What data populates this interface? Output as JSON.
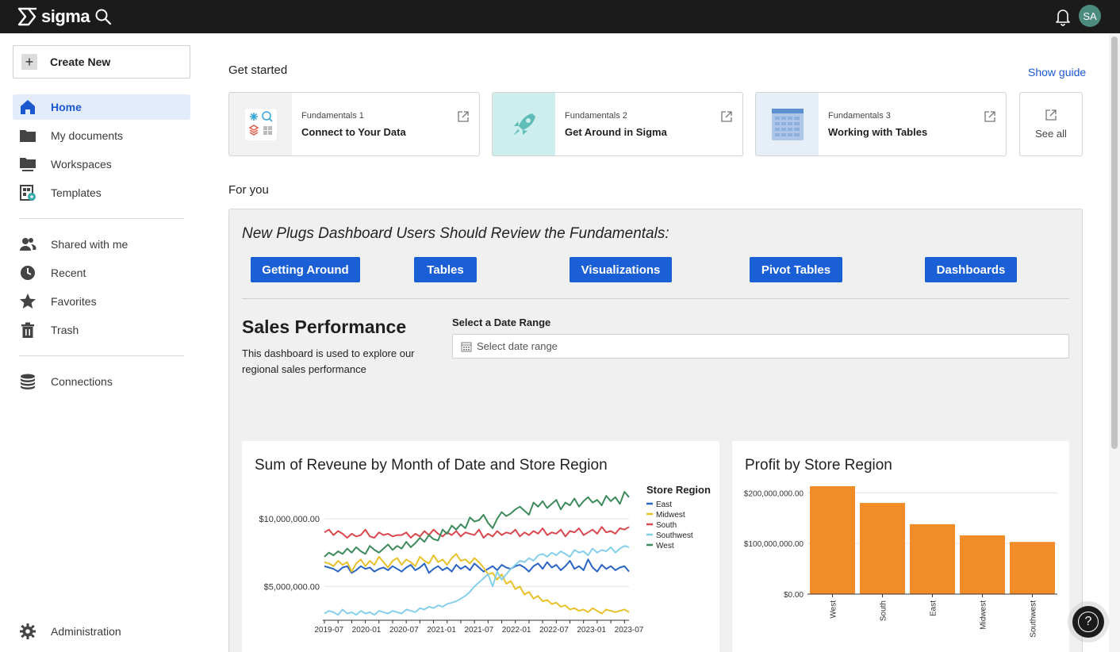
{
  "header": {
    "app_name": "sigma",
    "user_initials": "SA"
  },
  "sidebar": {
    "create_label": "Create New",
    "nav_primary": [
      {
        "label": "Home",
        "icon": "home-icon",
        "active": true
      },
      {
        "label": "My documents",
        "icon": "folder-icon"
      },
      {
        "label": "Workspaces",
        "icon": "workspaces-icon"
      },
      {
        "label": "Templates",
        "icon": "templates-icon"
      }
    ],
    "nav_secondary": [
      {
        "label": "Shared with me",
        "icon": "people-icon"
      },
      {
        "label": "Recent",
        "icon": "clock-icon"
      },
      {
        "label": "Favorites",
        "icon": "star-icon"
      },
      {
        "label": "Trash",
        "icon": "trash-icon"
      }
    ],
    "connections_label": "Connections",
    "administration_label": "Administration"
  },
  "main": {
    "get_started_heading": "Get started",
    "show_guide_label": "Show guide",
    "cards": [
      {
        "subtitle": "Fundamentals 1",
        "title": "Connect to Your Data"
      },
      {
        "subtitle": "Fundamentals 2",
        "title": "Get Around in Sigma"
      },
      {
        "subtitle": "Fundamentals 3",
        "title": "Working with Tables"
      }
    ],
    "see_all_label": "See all",
    "for_you_heading": "For you"
  },
  "dashboard": {
    "heading": "New Plugs Dashboard Users Should Review the Fundamentals:",
    "buttons": [
      "Getting Around",
      "Tables",
      "Visualizations",
      "Pivot Tables",
      "Dashboards"
    ],
    "title": "Sales Performance",
    "description": "This dashboard is used to explore our regional sales performance",
    "date_range_label": "Select a Date Range",
    "date_range_placeholder": "Select date range"
  },
  "colors": {
    "accent": "#1a5fd6",
    "east": "#2a64c4",
    "midwest": "#e8c12a",
    "south": "#d9474f",
    "southwest": "#86cfea",
    "west": "#3d8a5c",
    "bar": "#f28c28"
  },
  "chart_data": [
    {
      "type": "line",
      "title": "Sum of Reveune by Month of Date and Store Region",
      "legend_title": "Store Region",
      "legend_position": "right",
      "x_ticks": [
        "2019-07",
        "2020-01",
        "2020-07",
        "2021-01",
        "2021-07",
        "2022-01",
        "2022-07",
        "2023-01",
        "2023-07"
      ],
      "y_ticks": [
        {
          "value": 10000000,
          "label": "$10,000,000.00"
        },
        {
          "value": 5000000,
          "label": "$5,000,000.00"
        }
      ],
      "ylim": [
        2500000,
        12000000
      ],
      "grid": true,
      "series": [
        {
          "name": "East",
          "values": [
            6.5,
            6.4,
            6.3,
            6.1,
            6.4,
            6.5,
            6.0,
            6.2,
            6.5,
            6.3,
            6.4,
            6.1,
            6.3,
            6.4,
            6.2,
            6.5,
            6.3,
            6.1,
            6.4,
            6.6,
            6.2,
            6.4,
            6.7,
            6.0,
            6.3,
            6.5,
            6.2,
            6.4,
            6.1,
            6.6,
            6.3,
            6.5,
            6.2,
            6.7,
            6.4,
            6.1,
            6.3,
            6.5,
            6.2,
            6.6,
            6.4,
            6.3,
            6.5,
            6.6,
            6.4,
            6.1,
            6.5,
            6.7,
            6.3,
            6.8,
            6.4,
            6.6,
            6.2,
            6.5,
            6.9,
            6.3,
            6.5,
            6.2,
            7.0,
            6.4,
            6.1,
            6.6,
            6.3,
            6.5,
            6.2,
            6.4,
            6.5,
            6.1
          ]
        },
        {
          "name": "Midwest",
          "values": [
            6.8,
            6.7,
            6.5,
            6.9,
            6.6,
            6.8,
            6.1,
            6.7,
            7.0,
            6.5,
            6.9,
            6.6,
            7.2,
            6.8,
            6.4,
            6.9,
            7.1,
            6.6,
            7.0,
            6.8,
            6.5,
            7.2,
            6.9,
            6.7,
            7.3,
            6.8,
            7.0,
            6.6,
            7.1,
            7.4,
            6.9,
            7.0,
            6.7,
            7.1,
            6.8,
            6.4,
            5.9,
            6.0,
            5.5,
            5.9,
            5.2,
            5.4,
            4.8,
            5.0,
            4.4,
            4.6,
            4.1,
            4.3,
            3.9,
            4.0,
            3.7,
            3.8,
            3.5,
            3.6,
            3.3,
            3.4,
            3.2,
            3.3,
            3.1,
            3.4,
            3.2,
            3.0,
            3.3,
            3.2,
            3.1,
            3.2,
            3.3,
            3.1
          ]
        },
        {
          "name": "South",
          "values": [
            9.0,
            9.2,
            8.8,
            9.1,
            8.9,
            8.6,
            8.9,
            8.7,
            8.8,
            9.2,
            8.7,
            8.6,
            9.0,
            8.8,
            8.9,
            8.7,
            8.8,
            8.8,
            9.0,
            8.6,
            8.9,
            8.7,
            9.1,
            8.8,
            9.2,
            8.9,
            8.7,
            9.0,
            8.8,
            9.1,
            8.7,
            9.0,
            8.9,
            8.8,
            9.2,
            8.6,
            8.9,
            8.7,
            9.1,
            8.8,
            9.0,
            8.9,
            9.2,
            8.7,
            9.0,
            8.8,
            9.1,
            8.9,
            9.3,
            8.8,
            9.0,
            8.9,
            9.2,
            8.7,
            9.1,
            9.0,
            9.3,
            8.8,
            9.0,
            9.2,
            8.9,
            9.4,
            9.0,
            9.1,
            8.9,
            9.3,
            9.2,
            9.4
          ]
        },
        {
          "name": "Southwest",
          "values": [
            3.0,
            3.2,
            3.1,
            2.9,
            3.3,
            3.0,
            3.1,
            2.9,
            3.2,
            3.0,
            3.1,
            2.9,
            3.2,
            3.1,
            3.0,
            3.2,
            3.1,
            3.0,
            3.3,
            3.2,
            3.1,
            3.4,
            3.3,
            3.5,
            3.4,
            3.6,
            3.5,
            3.7,
            3.8,
            3.9,
            4.1,
            4.3,
            4.6,
            5.0,
            5.3,
            5.6,
            5.9,
            5.0,
            6.1,
            5.5,
            5.9,
            6.3,
            6.6,
            6.9,
            6.8,
            7.1,
            6.9,
            7.3,
            7.4,
            7.2,
            7.5,
            7.3,
            7.6,
            7.4,
            7.2,
            7.7,
            7.5,
            7.6,
            7.3,
            7.8,
            7.5,
            7.7,
            7.6,
            7.9,
            7.5,
            7.8,
            8.0,
            7.9
          ]
        },
        {
          "name": "West",
          "values": [
            7.2,
            7.5,
            7.3,
            7.6,
            7.4,
            7.8,
            7.5,
            7.9,
            7.6,
            7.4,
            8.0,
            7.7,
            7.5,
            7.8,
            8.1,
            7.7,
            8.0,
            7.8,
            8.3,
            7.9,
            8.2,
            8.6,
            8.3,
            8.8,
            8.5,
            8.4,
            9.2,
            8.9,
            9.5,
            9.2,
            9.6,
            9.3,
            10.1,
            9.8,
            9.9,
            10.3,
            9.7,
            9.3,
            10.0,
            10.5,
            10.2,
            10.4,
            10.7,
            10.9,
            10.6,
            10.3,
            11.2,
            10.9,
            11.3,
            10.8,
            11.1,
            11.4,
            10.7,
            11.2,
            11.0,
            11.5,
            10.9,
            11.3,
            11.6,
            11.2,
            11.4,
            11.0,
            11.7,
            11.3,
            11.6,
            11.1,
            12.0,
            11.6
          ]
        }
      ],
      "values_unit": "millions"
    },
    {
      "type": "bar",
      "title": "Profit by Store Region",
      "categories": [
        "West",
        "South",
        "East",
        "Midwest",
        "Southwest"
      ],
      "values": [
        213000000,
        180000000,
        138000000,
        116000000,
        103000000
      ],
      "y_ticks": [
        {
          "value": 200000000,
          "label": "$200,000,000.00"
        },
        {
          "value": 100000000,
          "label": "$100,000,000.00"
        },
        {
          "value": 0,
          "label": "$0.00"
        }
      ],
      "ylim": [
        0,
        213000000
      ],
      "grid": true
    }
  ]
}
